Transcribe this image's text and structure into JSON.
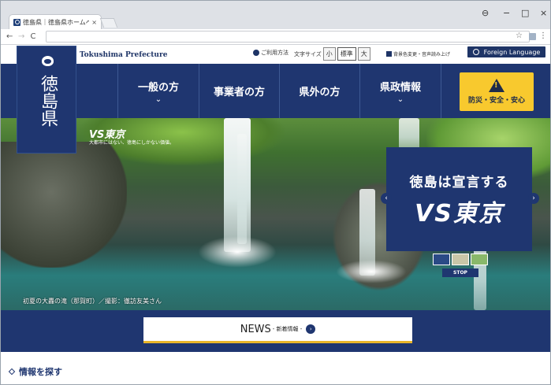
{
  "browser": {
    "tab_title": "徳島県｜徳島県ホームペー",
    "tab_close": "×",
    "window_controls": [
      "⊖",
      "−",
      "□",
      "×"
    ],
    "nav": {
      "back": "←",
      "forward": "→",
      "reload": "C"
    },
    "star": "☆",
    "menu": "⋮"
  },
  "site": {
    "name_en": "Tokushima Prefecture",
    "logo_text": "徳島県",
    "utility": {
      "usage": "ご利用方法",
      "font_size_label": "文字サイズ",
      "font_sizes": [
        "小",
        "標準",
        "大"
      ],
      "color_change": "背景色変更・音声読み上げ",
      "foreign_language": "Foreign Language"
    },
    "nav_items": [
      {
        "label": "一般の方",
        "chevron": "⌄"
      },
      {
        "label": "事業者の方",
        "chevron": ""
      },
      {
        "label": "県外の方",
        "chevron": ""
      },
      {
        "label": "県政情報",
        "chevron": "⌄"
      }
    ],
    "disaster_label": "防災・安全・安心"
  },
  "hero": {
    "campaign_small": "VS東京",
    "campaign_sub": "大都市にはない、徳島にしかない価値。",
    "slide_line1": "徳島は宣言する",
    "slide_line2": "VS東京",
    "caption": "初夏の大轟の滝（那賀町）／撮影：徹訪友美さん",
    "prev": "‹",
    "next": "›",
    "stop": "STOP"
  },
  "news": {
    "label": "NEWS",
    "sub": "- 新着情報 -",
    "go": "›"
  },
  "find": {
    "label": "情報を探す"
  },
  "colors": {
    "navy": "#1f3670",
    "accent_yellow": "#f8c92e"
  }
}
